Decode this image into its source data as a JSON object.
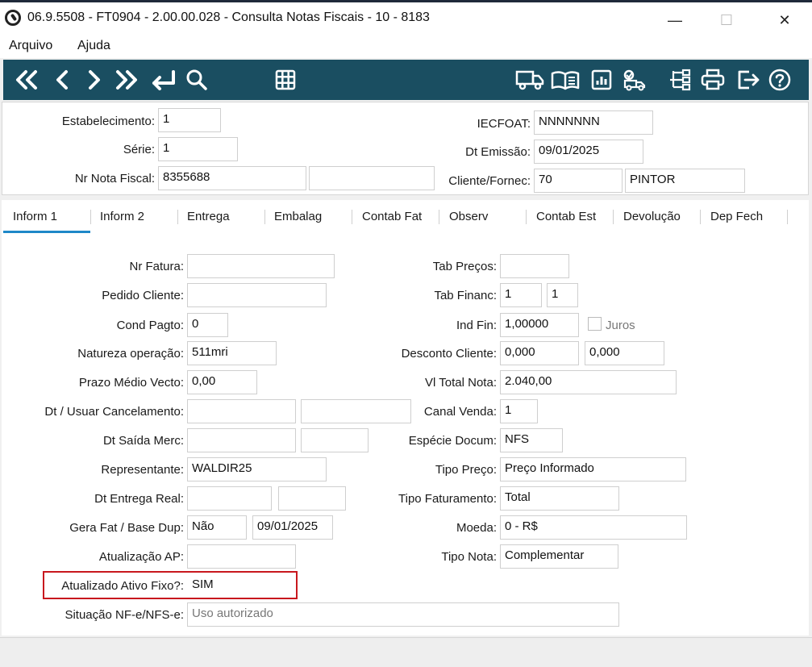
{
  "window": {
    "title": "06.9.5508 - FT0904 - 2.00.00.028 - Consulta Notas Fiscais - 10 - 8183",
    "minimize": "—",
    "maximize": "☐",
    "close": "✕"
  },
  "menu": {
    "items": [
      "Arquivo",
      "Ajuda"
    ]
  },
  "toolbar": {
    "left_icons": [
      "first-icon",
      "previous-icon",
      "next-icon",
      "last-icon",
      "goto-icon",
      "search-icon",
      "grid-icon"
    ],
    "right_icons": [
      "truck-icon",
      "book-icon",
      "report-icon",
      "delivery-icon",
      "hierarchy-icon",
      "print-icon",
      "exit-icon",
      "help-icon"
    ],
    "colors": {
      "background": "#1a4e61",
      "icon": "#ffffff"
    }
  },
  "header": {
    "estabelecimento": {
      "label": "Estabelecimento:",
      "value": "1"
    },
    "serie": {
      "label": "Série:",
      "value": "1"
    },
    "nr_nota_fiscal": {
      "label": "Nr Nota Fiscal:",
      "value": "8355688",
      "value2": ""
    },
    "iecfoat": {
      "label": "IECFOAT:",
      "value": "NNNNNNN"
    },
    "dt_emissao": {
      "label": "Dt Emissão:",
      "value": "09/01/2025"
    },
    "cliente_fornec": {
      "label": "Cliente/Fornec:",
      "code": "70",
      "name": "PINTOR"
    }
  },
  "tabs": [
    "Inform 1",
    "Inform 2",
    "Entrega",
    "Embalag",
    "Contab Fat",
    "Observ",
    "Contab Est",
    "Devolução",
    "Dep Fech"
  ],
  "active_tab": "Inform 1",
  "form": {
    "nr_fatura": {
      "label": "Nr Fatura:",
      "value": ""
    },
    "pedido_cliente": {
      "label": "Pedido Cliente:",
      "value": ""
    },
    "cond_pagto": {
      "label": "Cond Pagto:",
      "value": "0"
    },
    "natureza_operacao": {
      "label": "Natureza operação:",
      "value": "511mri"
    },
    "prazo_medio_vecto": {
      "label": "Prazo Médio Vecto:",
      "value": "0,00"
    },
    "dt_usuar_cancelamento": {
      "label": "Dt / Usuar Cancelamento:",
      "value1": "",
      "value2": ""
    },
    "dt_saida_merc": {
      "label": "Dt Saída Merc:",
      "value1": "",
      "value2": ""
    },
    "representante": {
      "label": "Representante:",
      "value": "WALDIR25"
    },
    "dt_entrega_real": {
      "label": "Dt Entrega Real:",
      "value1": "",
      "value2": ""
    },
    "gera_fat_base_dup": {
      "label": "Gera Fat / Base Dup:",
      "value1": "Não",
      "value2": "09/01/2025"
    },
    "atualizacao_ap": {
      "label": "Atualização AP:",
      "value": ""
    },
    "atualizado_ativo_fixo": {
      "label": "Atualizado Ativo Fixo?:",
      "value": "SIM"
    },
    "situacao_nfe": {
      "label": "Situação NF-e/NFS-e:",
      "value": "Uso autorizado"
    },
    "tab_precos": {
      "label": "Tab Preços:",
      "value": ""
    },
    "tab_financ": {
      "label": "Tab Financ:",
      "value1": "1",
      "value2": "1"
    },
    "ind_fin": {
      "label": "Ind Fin:",
      "value": "1,00000",
      "juros_label": "Juros",
      "juros_checked": false
    },
    "desconto_cliente": {
      "label": "Desconto Cliente:",
      "value1": "0,000",
      "value2": "0,000"
    },
    "vl_total_nota": {
      "label": "Vl Total Nota:",
      "value": "2.040,00"
    },
    "canal_venda": {
      "label": "Canal Venda:",
      "value": "1"
    },
    "especie_docum": {
      "label": "Espécie Docum:",
      "value": "NFS"
    },
    "tipo_preco": {
      "label": "Tipo Preço:",
      "value": "Preço Informado"
    },
    "tipo_faturamento": {
      "label": "Tipo Faturamento:",
      "value": "Total"
    },
    "moeda": {
      "label": "Moeda:",
      "value": "0 - R$"
    },
    "tipo_nota": {
      "label": "Tipo Nota:",
      "value": "Complementar"
    }
  },
  "highlight_color": "#c8181e"
}
